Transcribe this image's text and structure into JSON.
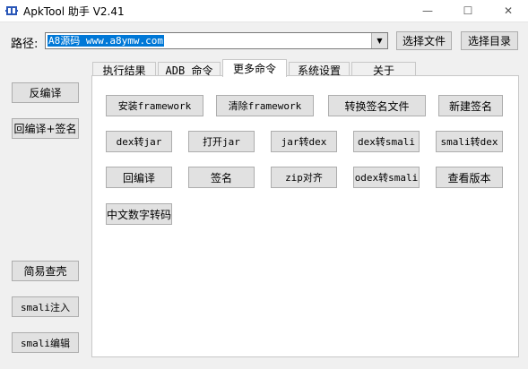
{
  "window": {
    "title": "ApkTool 助手 V2.41",
    "min_glyph": "—",
    "max_glyph": "☐",
    "close_glyph": "✕"
  },
  "path_bar": {
    "label": "路径:",
    "value": "A8源码 www.a8ymw.com",
    "choose_file": "选择文件",
    "choose_dir": "选择目录"
  },
  "left_buttons": {
    "decompile": "反编译",
    "recompile_sign": "回编译+签名",
    "simple_unpack": "简易查壳",
    "smali_inject": "smali注入",
    "smali_edit": "smali编辑"
  },
  "tabs": [
    {
      "label": "执行结果"
    },
    {
      "label": "ADB 命令"
    },
    {
      "label": "更多命令"
    },
    {
      "label": "系统设置"
    },
    {
      "label": "关于"
    }
  ],
  "more_commands": {
    "install_framework": "安装framework",
    "clear_framework": "清除framework",
    "convert_sign_file": "转换签名文件",
    "new_signature": "新建签名",
    "dex_to_jar": "dex转jar",
    "open_jar": "打开jar",
    "jar_to_dex": "jar转dex",
    "dex_to_smali": "dex转smali",
    "smali_to_dex": "smali转dex",
    "recompile": "回编译",
    "sign": "签名",
    "zip_align": "zip对齐",
    "odex_to_smali": "odex转smali",
    "view_version": "查看版本",
    "chinese_transcode": "中文数字转码"
  }
}
